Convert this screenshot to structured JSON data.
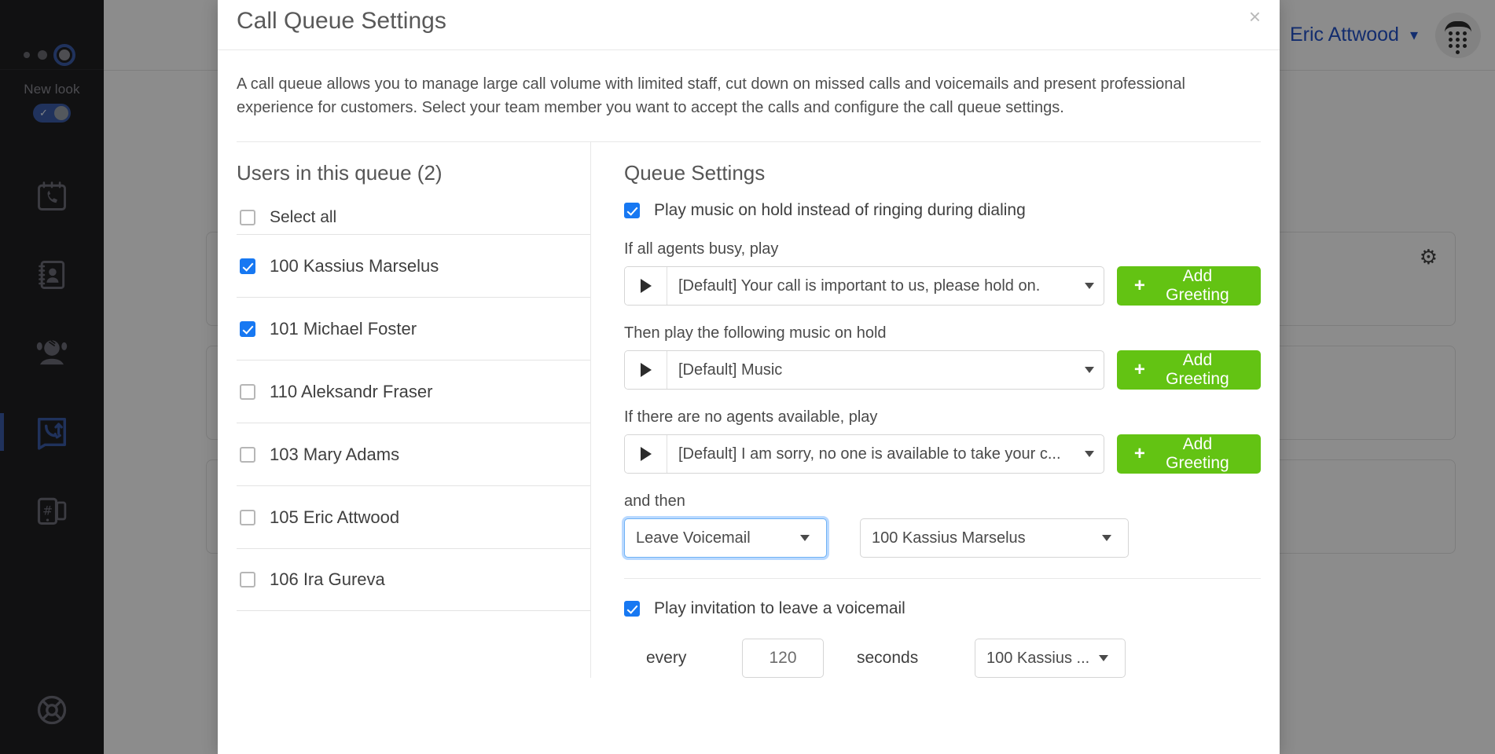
{
  "sidebar": {
    "new_look_label": "New look",
    "nav_items": [
      {
        "name": "call-history-icon",
        "label": "Call History"
      },
      {
        "name": "contacts-icon",
        "label": "Contacts"
      },
      {
        "name": "agent-headset-icon",
        "label": "Agents"
      },
      {
        "name": "call-routing-icon",
        "label": "Call Routing"
      },
      {
        "name": "phone-numbers-icon",
        "label": "Phone Numbers"
      },
      {
        "name": "support-lifebuoy-icon",
        "label": "Support"
      }
    ]
  },
  "topbar": {
    "user_name": "Eric Attwood"
  },
  "modal": {
    "title": "Call Queue Settings",
    "close_label": "×",
    "description": "A call queue allows you to manage large call volume with limited staff, cut down on missed calls and voicemails and present professional experience for customers. Select your team member you want to accept the calls and configure the call queue settings."
  },
  "users_panel": {
    "title": "Users in this queue (2)",
    "select_all_label": "Select all",
    "select_all_checked": false,
    "users": [
      {
        "label": "100 Kassius Marselus",
        "checked": true
      },
      {
        "label": "101 Michael Foster",
        "checked": true
      },
      {
        "label": "110 Aleksandr Fraser",
        "checked": false
      },
      {
        "label": "103 Mary Adams",
        "checked": false
      },
      {
        "label": "105 Eric Attwood",
        "checked": false
      },
      {
        "label": "106 Ira Gureva",
        "checked": false
      }
    ]
  },
  "queue_settings": {
    "title": "Queue Settings",
    "music_on_hold": {
      "label": "Play music on hold instead of ringing during dialing",
      "checked": true
    },
    "all_busy": {
      "label": "If all agents busy, play",
      "value": "[Default] Your call is important to us, please hold on.",
      "button_label": "Add Greeting",
      "plus": "+"
    },
    "music_hold": {
      "label": "Then play the following music on hold",
      "value": "[Default] Music",
      "button_label": "Add Greeting",
      "plus": "+"
    },
    "no_agents": {
      "label": "If there are no agents available, play",
      "value": "[Default] I am sorry, no one is available to take your c...",
      "button_label": "Add Greeting",
      "plus": "+"
    },
    "and_then": {
      "label": "and then",
      "action_value": "Leave Voicemail",
      "target_value": "100 Kassius Marselus"
    },
    "voicemail_invitation": {
      "label": "Play invitation to leave a voicemail",
      "checked": true,
      "every_label": "every",
      "interval_value": "120",
      "seconds_label": "seconds",
      "target_value": "100 Kassius ..."
    }
  },
  "colors": {
    "accent_green": "#63c313",
    "accent_blue": "#1778f2",
    "link_blue": "#2452c9",
    "sidebar_bg": "#1f1f22"
  }
}
